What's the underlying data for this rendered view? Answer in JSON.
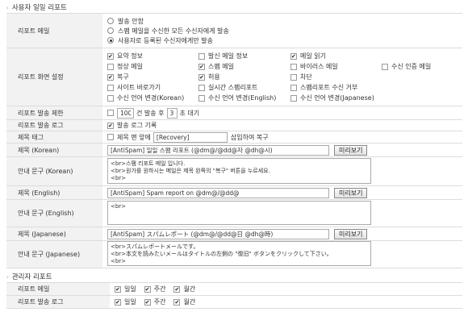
{
  "user_report": {
    "section_title": "사용자 일일 리포트",
    "report_mail": {
      "label": "리포트 메일",
      "options": [
        "발송 안함",
        "스팸 메일을 수신한 모든 수신자에게 발송",
        "사용자로 등록된 수신자에게만 발송"
      ],
      "selected_index": 2
    },
    "screen_settings": {
      "label": "리포트 화면 설정",
      "items": [
        {
          "label": "요약 정보",
          "checked": true
        },
        {
          "label": "발신 메일 정보",
          "checked": false
        },
        {
          "label": "메일 읽기",
          "checked": true
        },
        {
          "label": "",
          "checked": null
        },
        {
          "label": "정상 메일",
          "checked": false
        },
        {
          "label": "스팸 메일",
          "checked": true
        },
        {
          "label": "바이러스 메일",
          "checked": false
        },
        {
          "label": "수신 인증 메일",
          "checked": false
        },
        {
          "label": "복구",
          "checked": true
        },
        {
          "label": "허용",
          "checked": true
        },
        {
          "label": "차단",
          "checked": false
        },
        {
          "label": "",
          "checked": null
        },
        {
          "label": "사이트 바로가기",
          "checked": false
        },
        {
          "label": "실시간 스팸리포트",
          "checked": false
        },
        {
          "label": "스팸리포트 수신 거부",
          "checked": false
        },
        {
          "label": "",
          "checked": null
        },
        {
          "label": "수신 언어 변경(Korean)",
          "checked": false
        },
        {
          "label": "수신 언어 변경(English)",
          "checked": false
        },
        {
          "label": "수신 언어 변경(Japanese)",
          "checked": false
        },
        {
          "label": "",
          "checked": null
        }
      ]
    },
    "send_limit": {
      "label": "리포트 발송 제한",
      "count_value": "100",
      "text_mid": "건 발송 후",
      "wait_value": "3",
      "text_end": "초 대기"
    },
    "send_log": {
      "label": "리포트 발송 로그",
      "checkbox_label": "발송 로그 기록",
      "checked": true
    },
    "subject_tag": {
      "label": "제목 태그",
      "checkbox_label": "제목 맨 앞에",
      "tag_value": "[Recovery]",
      "suffix": "삽입하여 복구",
      "checked": false
    },
    "subject_korean": {
      "label": "제목 (Korean)",
      "value": "[AntiSpam] 일일 스팸 리포트 (@dm@/@dd@자 @dh@시)"
    },
    "notice_korean": {
      "label": "안내 문구 (Korean)",
      "value": "<br>스팸 리포트 메일 입니다.\n<br>원가를 원하시는 메일은 제목 왼쪽의 \"복구\" 버튼을 누르세요.\n<br>"
    },
    "subject_english": {
      "label": "제목 (English)",
      "value": "[AntiSpam] Spam report on @dm@/@dd@"
    },
    "notice_english": {
      "label": "안내 문구 (English)",
      "value": "<br>"
    },
    "subject_japanese": {
      "label": "제목 (Japanese)",
      "value": "[AntiSpam] スパムレポート (@dm@/@dd@日 @dh@時)"
    },
    "notice_japanese": {
      "label": "안내 문구 (Japanese)",
      "value": "<br>スパムレポートメールです。\n<br>本文を読みたいメールはタイトルの左側の \"復旧\" ボタンをクリックして下さい。\n<br>"
    },
    "preview_label": "미리보기"
  },
  "admin_report": {
    "section_title": "관리자 리포트",
    "report_mail": {
      "label": "리포트 메일",
      "options": [
        {
          "label": "일일",
          "checked": true
        },
        {
          "label": "주간",
          "checked": true
        },
        {
          "label": "월간",
          "checked": true
        }
      ]
    },
    "send_log": {
      "label": "리포트 발송 로그",
      "options": [
        {
          "label": "일일",
          "checked": true
        },
        {
          "label": "주간",
          "checked": true
        },
        {
          "label": "월간",
          "checked": true
        }
      ]
    }
  }
}
